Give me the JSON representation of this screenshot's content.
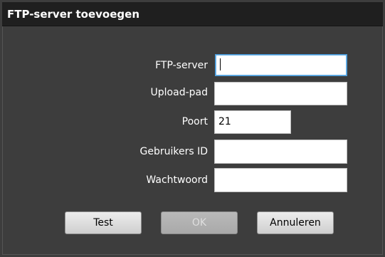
{
  "dialog": {
    "title": "FTP-server toevoegen"
  },
  "form": {
    "ftp_server": {
      "label": "FTP-server",
      "value": ""
    },
    "upload_path": {
      "label": "Upload-pad",
      "value": ""
    },
    "port": {
      "label": "Poort",
      "value": "21"
    },
    "user_id": {
      "label": "Gebruikers ID",
      "value": ""
    },
    "password": {
      "label": "Wachtwoord",
      "value": ""
    }
  },
  "buttons": {
    "test": "Test",
    "ok": "OK",
    "cancel": "Annuleren"
  },
  "colors": {
    "dialog_bg": "#3d3d3d",
    "titlebar_bg": "#1f1f1f",
    "focus_border": "#4a9ad8"
  }
}
